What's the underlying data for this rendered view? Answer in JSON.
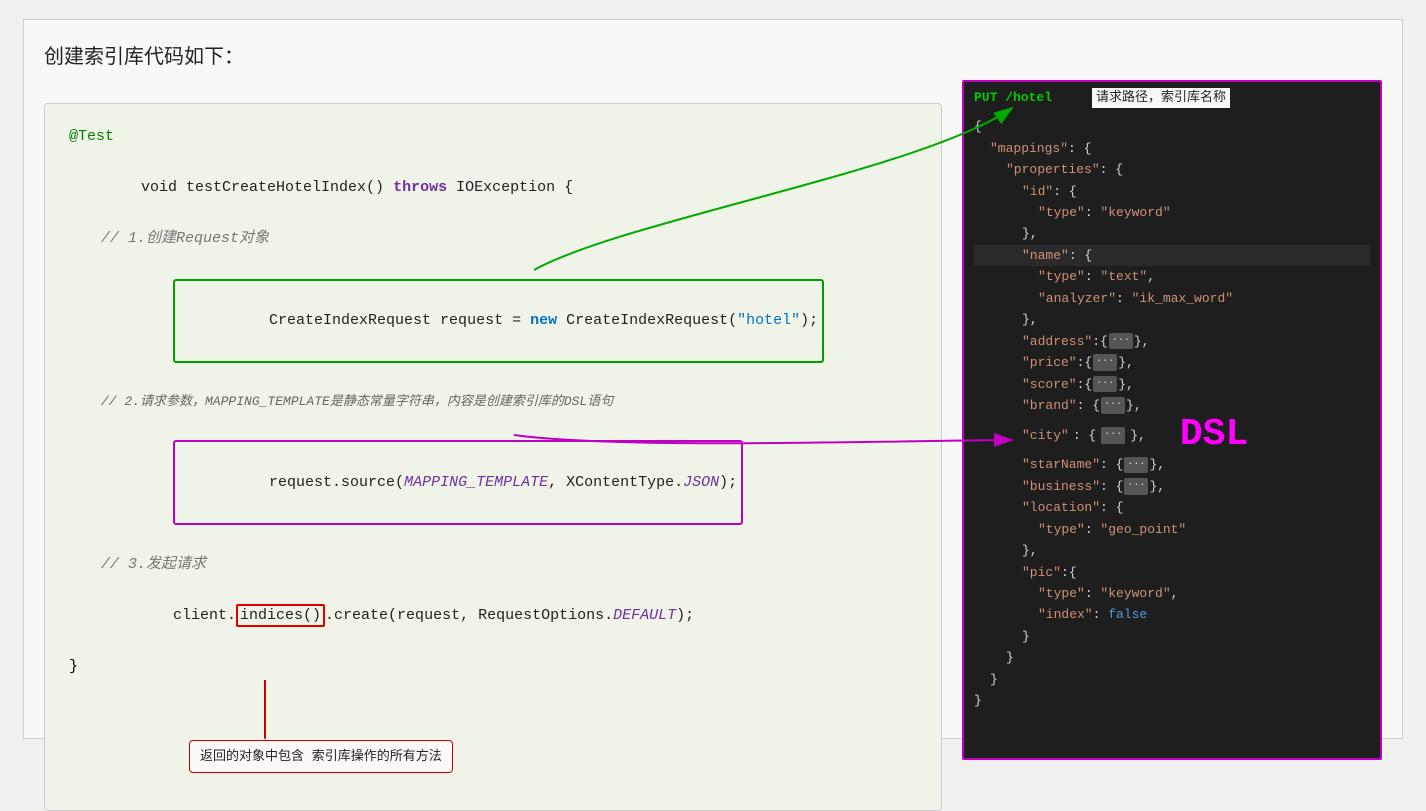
{
  "page": {
    "title": "创建索引库代码如下："
  },
  "code": {
    "annotation_test": "@Test",
    "method_signature": "void testCreateHotelIndex() throws IOException {",
    "comment1": "// 1.创建Request对象",
    "line_create": "CreateIndexRequest request = new CreateIndexRequest(\"hotel\");",
    "comment2": "// 2.请求参数，MAPPING_TEMPLATE是静态常量字符串，内容是创建索引库的DSL语句",
    "line_source": "request.source(MAPPING_TEMPLATE, XContentType.JSON);",
    "comment3": "// 3.发起请求",
    "line_client": "client.indices().create(request, RequestOptions.DEFAULT);",
    "closing": "}",
    "balloon_text": "返回的对象中包含\n索引库操作的所有方法"
  },
  "right_panel": {
    "method": "PUT /hotel",
    "annotation": "请求路径，索引库名称",
    "dsl_label": "DSL",
    "json_lines": [
      "{",
      "  \"mappings\": {",
      "    \"properties\": {",
      "      \"id\": {",
      "        \"type\": \"keyword\"",
      "      },",
      "      \"name\": {",
      "        \"type\": \"text\",",
      "        \"analyzer\": \"ik_max_word\"",
      "      },",
      "      \"address\":{...},",
      "      \"price\":{...},",
      "      \"score\":{...},",
      "      \"brand\": {...},",
      "      \"city\": {...},",
      "      \"starName\": {...},",
      "      \"business\": {...},",
      "      \"location\": {",
      "        \"type\": \"geo_point\"",
      "      },",
      "      \"pic\":{",
      "        \"type\": \"keyword\",",
      "        \"index\": false",
      "      }",
      "    }",
      "  }",
      "}"
    ]
  }
}
